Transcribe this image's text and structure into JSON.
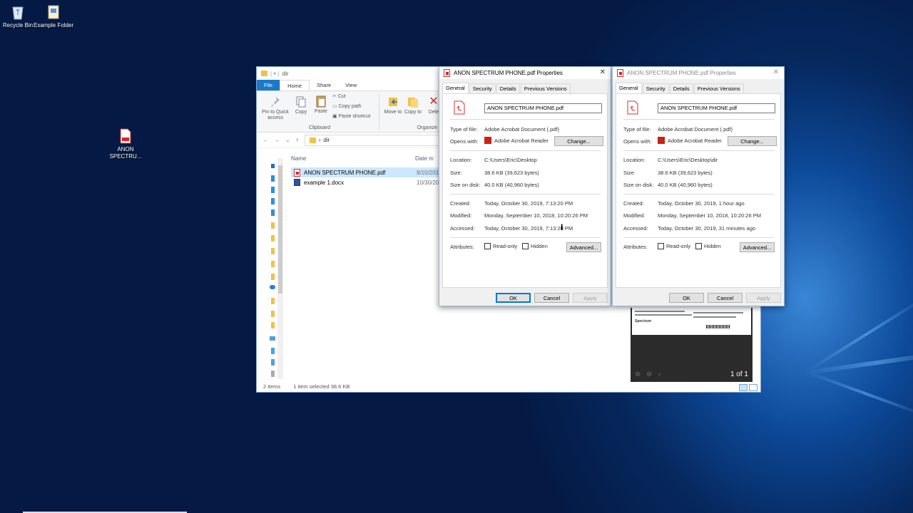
{
  "desktop": {
    "icons": [
      {
        "label": "Recycle Bin"
      },
      {
        "label": "Example Folder"
      },
      {
        "label": "ANON SPECTRU..."
      }
    ]
  },
  "explorer": {
    "title": "dir",
    "ribbon_tabs": [
      "File",
      "Home",
      "Share",
      "View"
    ],
    "ribbon": {
      "pin_label": "Pin to Quick access",
      "copy_label": "Copy",
      "paste_label": "Paste",
      "cut_label": "Cut",
      "copy_path_label": "Copy path",
      "paste_shortcut_label": "Paste shortcut",
      "clipboard_group": "Clipboard",
      "move_to_label": "Move to",
      "copy_to_label": "Copy to",
      "delete_label": "Dele",
      "organize_group": "Organize"
    },
    "address": {
      "path": "dir"
    },
    "columns": {
      "name": "Name",
      "date": "Date m"
    },
    "files": [
      {
        "name": "ANON SPECTRUM PHONE.pdf",
        "date": "9/10/201",
        "selected": true
      },
      {
        "name": "example 1.docx",
        "date": "10/30/20",
        "selected": false
      }
    ],
    "status": {
      "items": "2 items",
      "selected": "1 item selected  38.6 KB"
    },
    "preview": {
      "pager": "1 of 1",
      "logo": "Spectrum"
    }
  },
  "dialogs": [
    {
      "title": "ANON SPECTRUM PHONE.pdf Properties",
      "tabs": [
        "General",
        "Security",
        "Details",
        "Previous Versions"
      ],
      "file_name": "ANON SPECTRUM PHONE.pdf",
      "type_label": "Type of file:",
      "type_value": "Adobe Acrobat Document (.pdf)",
      "opens_label": "Opens with:",
      "opens_value": "Adobe Acrobat Reader",
      "change_label": "Change...",
      "location_label": "Location:",
      "location_value": "C:\\Users\\Eric\\Desktop",
      "size_label": "Size:",
      "size_value": "38.6 KB (39,623 bytes)",
      "disk_label": "Size on disk:",
      "disk_value": "40.0 KB (40,960 bytes)",
      "created_label": "Created:",
      "created_value": "Today, October 30, 2019, 7:13:20 PM",
      "modified_label": "Modified:",
      "modified_value": "Monday, September 10, 2018, 10:20:26 PM",
      "accessed_label": "Accessed:",
      "accessed_value": "Today, October 30, 2019, 7:13:20 PM",
      "attributes_label": "Attributes:",
      "readonly_label": "Read-only",
      "hidden_label": "Hidden",
      "advanced_label": "Advanced...",
      "ok_label": "OK",
      "cancel_label": "Cancel",
      "apply_label": "Apply"
    },
    {
      "title": "ANON SPECTRUM PHONE.pdf Properties",
      "tabs": [
        "General",
        "Security",
        "Details",
        "Previous Versions"
      ],
      "file_name": "ANON SPECTRUM PHONE.pdf",
      "type_label": "Type of file:",
      "type_value": "Adobe Acrobat Document (.pdf)",
      "opens_label": "Opens with:",
      "opens_value": "Adobe Acrobat Reader",
      "change_label": "Change...",
      "location_label": "Location:",
      "location_value": "C:\\Users\\Eric\\Desktop\\dir",
      "size_label": "Size:",
      "size_value": "38.6 KB (39,623 bytes)",
      "disk_label": "Size on disk:",
      "disk_value": "40.0 KB (40,960 bytes)",
      "created_label": "Created:",
      "created_value": "Today, October 30, 2019, 1 hour ago",
      "modified_label": "Modified:",
      "modified_value": "Monday, September 10, 2018, 10:20:26 PM",
      "accessed_label": "Accessed:",
      "accessed_value": "Today, October 30, 2019, 31 minutes ago",
      "attributes_label": "Attributes:",
      "readonly_label": "Read-only",
      "hidden_label": "Hidden",
      "advanced_label": "Advanced...",
      "ok_label": "OK",
      "cancel_label": "Cancel",
      "apply_label": "Apply"
    }
  ]
}
